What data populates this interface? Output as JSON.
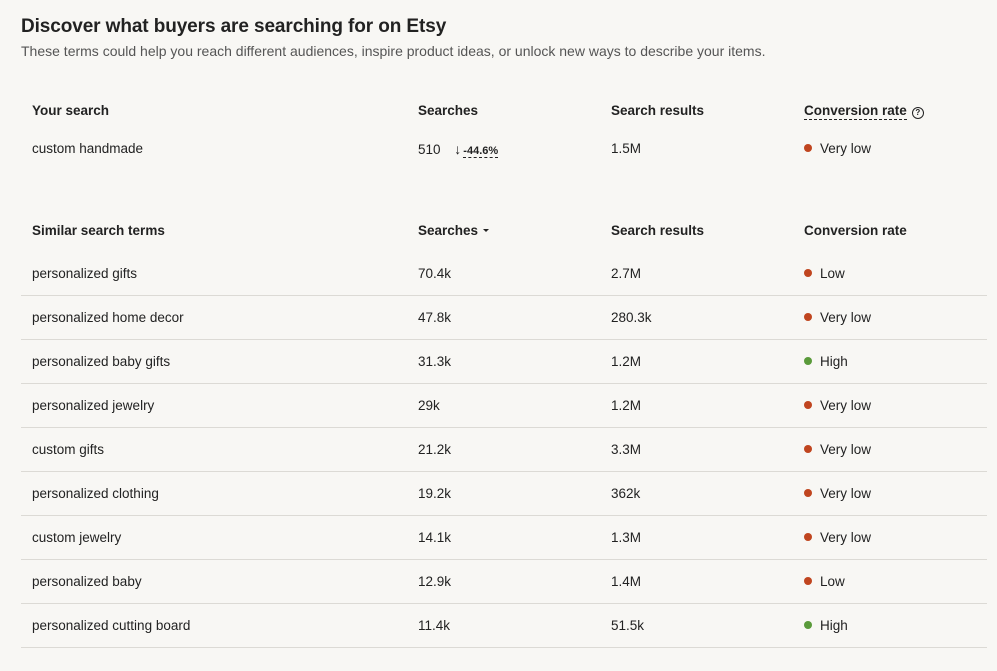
{
  "header": {
    "title": "Discover what buyers are searching for on Etsy",
    "subtitle": "These terms could help you reach different audiences, inspire product ideas, or unlock new ways to describe your items."
  },
  "your_search": {
    "headers": {
      "term": "Your search",
      "searches": "Searches",
      "results": "Search results",
      "conversion": "Conversion rate"
    },
    "row": {
      "term": "custom handmade",
      "searches": "510",
      "trend": "-44.6%",
      "results": "1.5M",
      "conversion": "Very low"
    }
  },
  "similar": {
    "headers": {
      "term": "Similar search terms",
      "searches": "Searches",
      "results": "Search results",
      "conversion": "Conversion rate"
    },
    "rows": [
      {
        "term": "personalized gifts",
        "searches": "70.4k",
        "results": "2.7M",
        "conversion": "Low"
      },
      {
        "term": "personalized home decor",
        "searches": "47.8k",
        "results": "280.3k",
        "conversion": "Very low"
      },
      {
        "term": "personalized baby gifts",
        "searches": "31.3k",
        "results": "1.2M",
        "conversion": "High"
      },
      {
        "term": "personalized jewelry",
        "searches": "29k",
        "results": "1.2M",
        "conversion": "Very low"
      },
      {
        "term": "custom gifts",
        "searches": "21.2k",
        "results": "3.3M",
        "conversion": "Very low"
      },
      {
        "term": "personalized clothing",
        "searches": "19.2k",
        "results": "362k",
        "conversion": "Very low"
      },
      {
        "term": "custom jewelry",
        "searches": "14.1k",
        "results": "1.3M",
        "conversion": "Very low"
      },
      {
        "term": "personalized baby",
        "searches": "12.9k",
        "results": "1.4M",
        "conversion": "Low"
      },
      {
        "term": "personalized cutting board",
        "searches": "11.4k",
        "results": "51.5k",
        "conversion": "High"
      }
    ]
  },
  "colors": {
    "low": "#c0451f",
    "high": "#5a9a3a",
    "background": "#f8f7f4",
    "divider": "#dcdad5"
  },
  "icons": {
    "help": "question-circle-icon",
    "trend_down": "arrow-down-icon",
    "sort": "caret-down-icon",
    "status": "status-dot-icon"
  }
}
